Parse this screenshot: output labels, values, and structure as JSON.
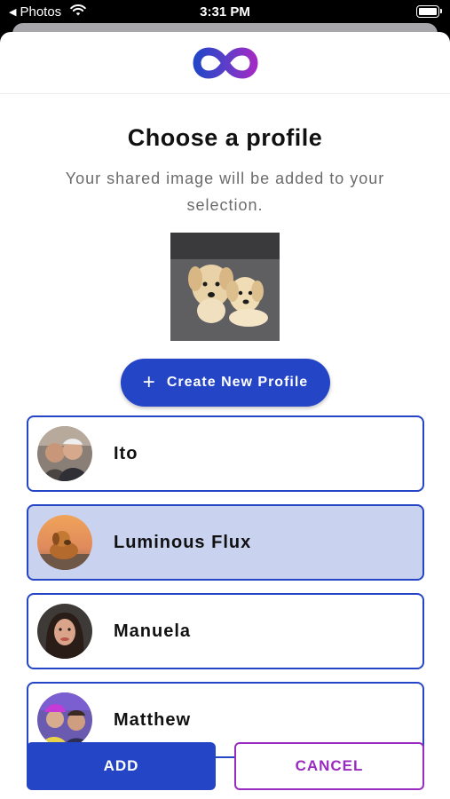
{
  "status_bar": {
    "back_app": "Photos",
    "time": "3:31 PM"
  },
  "header": {
    "logo_icon": "infinity-logo-icon",
    "brand_colors": [
      "#2545c7",
      "#9a2bc0"
    ]
  },
  "main": {
    "title": "Choose a profile",
    "subtitle": "Your shared image will be added to your selection.",
    "create_button": "Create New Profile"
  },
  "profiles": [
    {
      "name": "Ito",
      "selected": false
    },
    {
      "name": "Luminous Flux",
      "selected": true
    },
    {
      "name": "Manuela",
      "selected": false
    },
    {
      "name": "Matthew",
      "selected": false
    }
  ],
  "actions": {
    "add_label": "ADD",
    "cancel_label": "CANCEL"
  },
  "colors": {
    "accent": "#2545c7",
    "cancel": "#9a2bc0",
    "selected_row": "#c9d2ef"
  }
}
